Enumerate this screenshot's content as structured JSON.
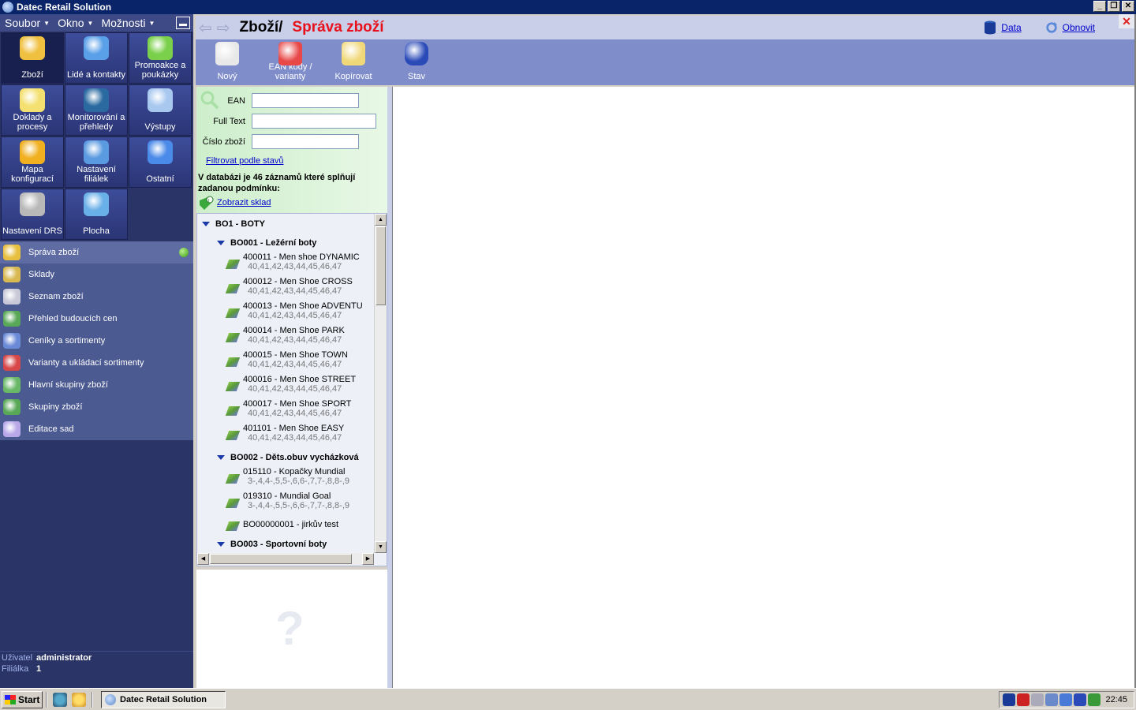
{
  "window": {
    "title": "Datec Retail Solution"
  },
  "menu": [
    "Soubor",
    "Okno",
    "Možnosti"
  ],
  "tiles": [
    {
      "label": "Zboží",
      "icon": "goods-icon",
      "color": "#f0c040",
      "active": true
    },
    {
      "label": "Lidé a kontakty",
      "icon": "contacts-book-icon",
      "color": "#5aa0e8"
    },
    {
      "label": "Promoakce a poukázky",
      "icon": "percent-icon",
      "color": "#7ad04a"
    },
    {
      "label": "Doklady a procesy",
      "icon": "documents-icon",
      "color": "#f4e070"
    },
    {
      "label": "Monitorování a přehledy",
      "icon": "globe-monitor-icon",
      "color": "#2a6aa0"
    },
    {
      "label": "Výstupy",
      "icon": "printer-icon",
      "color": "#a8c8f0"
    },
    {
      "label": "Mapa konfigurací",
      "icon": "star-map-icon",
      "color": "#f0b020"
    },
    {
      "label": "Nastavení filiálek",
      "icon": "house-icon",
      "color": "#5a9ae0"
    },
    {
      "label": "Ostatní",
      "icon": "star-icon",
      "color": "#4a8ae8"
    },
    {
      "label": "Nastavení DRS",
      "icon": "gear-icon",
      "color": "#b8b8b8"
    },
    {
      "label": "Plocha",
      "icon": "desktop-icon",
      "color": "#6ab0e8"
    }
  ],
  "nav": [
    {
      "label": "Správa zboží",
      "icon": "wrench-pencil-icon",
      "active": true
    },
    {
      "label": "Sklady",
      "icon": "warehouse-truck-icon"
    },
    {
      "label": "Seznam zboží",
      "icon": "barcode-list-icon"
    },
    {
      "label": "Přehled budoucích cen",
      "icon": "price-tag-icon"
    },
    {
      "label": "Ceníky a sortimenty",
      "icon": "pricelist-icon"
    },
    {
      "label": "Varianty a ukládací sortimenty",
      "icon": "variants-balls-icon"
    },
    {
      "label": "Hlavní skupiny zboží",
      "icon": "main-groups-icon"
    },
    {
      "label": "Skupiny zboží",
      "icon": "groups-icon"
    },
    {
      "label": "Editace sad",
      "icon": "sets-icon"
    }
  ],
  "user": {
    "user_label": "Uživatel",
    "user_value": "administrator",
    "branch_label": "Filiálka",
    "branch_value": "1"
  },
  "header": {
    "crumb": "Zboží/",
    "title": "Správa zboží",
    "data_link": "Data",
    "refresh_link": "Obnovit"
  },
  "toolbar": [
    {
      "label": "Nový",
      "icon": "new-barcode-icon"
    },
    {
      "label": "EAN kódy / varianty",
      "icon": "ean-variants-icon"
    },
    {
      "label": "Kopírovat",
      "icon": "copy-icon"
    },
    {
      "label": "Stav",
      "icon": "database-icon"
    }
  ],
  "filter": {
    "ean_label": "EAN",
    "ean_value": "",
    "fulltext_label": "Full Text",
    "fulltext_value": "",
    "number_label": "Číslo zboží",
    "number_value": "",
    "state_link": "Filtrovat podle stavů",
    "count_message": "V databázi je 46 záznamů které splňují zadanou podmínku:",
    "stock_link": "Zobrazit sklad"
  },
  "tree": {
    "groups": [
      {
        "label": "BO1 - BOTY",
        "level": 0
      },
      {
        "label": "BO001 - Ležérní boty",
        "level": 1
      },
      {
        "label": "BO002 - Děts.obuv vycházková",
        "level": 1
      },
      {
        "label": "BO003 - Sportovní boty",
        "level": 1
      }
    ],
    "items": [
      {
        "name": "400011 - Men shoe DYNAMIC",
        "sizes": "40,41,42,43,44,45,46,47"
      },
      {
        "name": "400012 - Men Shoe CROSS",
        "sizes": "40,41,42,43,44,45,46,47"
      },
      {
        "name": "400013 - Men Shoe ADVENTU",
        "sizes": "40,41,42,43,44,45,46,47"
      },
      {
        "name": "400014 - Men Shoe PARK",
        "sizes": "40,41,42,43,44,45,46,47"
      },
      {
        "name": "400015 - Men Shoe TOWN",
        "sizes": "40,41,42,43,44,45,46,47"
      },
      {
        "name": "400016 - Men Shoe STREET",
        "sizes": "40,41,42,43,44,45,46,47"
      },
      {
        "name": "400017 - Men Shoe SPORT",
        "sizes": "40,41,42,43,44,45,46,47"
      },
      {
        "name": "401101 - Men Shoe EASY",
        "sizes": "40,41,42,43,44,45,46,47"
      },
      {
        "name": "015110 - Kopačky Mundial",
        "sizes": "3-,4,4-,5,5-,6,6-,7,7-,8,8-,9"
      },
      {
        "name": "019310 - Mundial Goal",
        "sizes": "3-,4,4-,5,5-,6,6-,7,7-,8,8-,9"
      },
      {
        "name": "BO00000001 - jirkův test",
        "sizes": ""
      }
    ]
  },
  "help": {
    "symbol": "?"
  },
  "taskbar": {
    "start": "Start",
    "task": "Datec Retail Solution",
    "clock": "22:45"
  }
}
